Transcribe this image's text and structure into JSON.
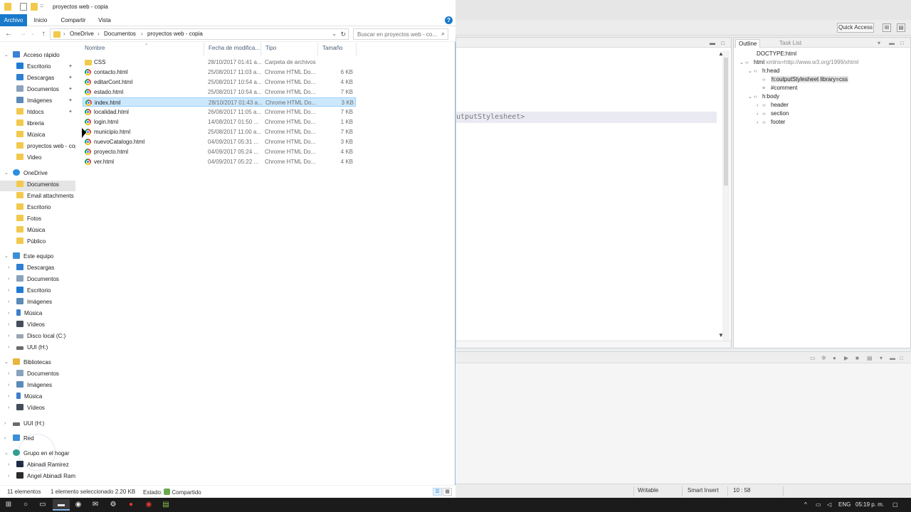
{
  "explorer": {
    "title": "proyectos web - copia",
    "ribbon_tabs": [
      "Archivo",
      "Inicio",
      "Compartir",
      "Vista"
    ],
    "help_label": "?",
    "breadcrumbs": [
      "OneDrive",
      "Documentos",
      "proyectos web - copia"
    ],
    "search_placeholder": "Buscar en proyectos web - co...",
    "columns": {
      "name": "Nombre",
      "date": "Fecha de modifica...",
      "type": "Tipo",
      "size": "Tamaño"
    },
    "files": [
      {
        "name": "CSS",
        "date": "28/10/2017 01:41 a...",
        "type": "Carpeta de archivos",
        "size": "",
        "icon": "folder-icon"
      },
      {
        "name": "contacto.html",
        "date": "25/08/2017 11:03 a...",
        "type": "Chrome HTML Do...",
        "size": "6 KB",
        "icon": "chrome-icon"
      },
      {
        "name": "editarCont.html",
        "date": "25/08/2017 10:54 a...",
        "type": "Chrome HTML Do...",
        "size": "4 KB",
        "icon": "chrome-icon"
      },
      {
        "name": "estado.html",
        "date": "25/08/2017 10:54 a...",
        "type": "Chrome HTML Do...",
        "size": "7 KB",
        "icon": "chrome-icon"
      },
      {
        "name": "index.html",
        "date": "28/10/2017 01:43 a...",
        "type": "Chrome HTML Do...",
        "size": "3 KB",
        "icon": "chrome-icon",
        "selected": true
      },
      {
        "name": "localidad.html",
        "date": "26/08/2017 11:05 a...",
        "type": "Chrome HTML Do...",
        "size": "7 KB",
        "icon": "chrome-icon"
      },
      {
        "name": "login.html",
        "date": "14/08/2017 01:50 ...",
        "type": "Chrome HTML Do...",
        "size": "1 KB",
        "icon": "chrome-icon"
      },
      {
        "name": "municipio.html",
        "date": "25/08/2017 11:00 a...",
        "type": "Chrome HTML Do...",
        "size": "7 KB",
        "icon": "chrome-icon"
      },
      {
        "name": "nuevoCatalogo.html",
        "date": "04/09/2017 05:31 ...",
        "type": "Chrome HTML Do...",
        "size": "3 KB",
        "icon": "chrome-icon"
      },
      {
        "name": "proyecto.html",
        "date": "04/09/2017 05:24 ...",
        "type": "Chrome HTML Do...",
        "size": "4 KB",
        "icon": "chrome-icon"
      },
      {
        "name": "ver.html",
        "date": "04/09/2017 05:22 ...",
        "type": "Chrome HTML Do...",
        "size": "4 KB",
        "icon": "chrome-icon"
      }
    ],
    "nav": {
      "quick_access": "Acceso rápido",
      "quick_items": [
        "Escritorio",
        "Descargas",
        "Documentos",
        "Imágenes",
        "htdocs",
        "libreria",
        "Música",
        "proyectos web - copia",
        "Video"
      ],
      "onedrive": "OneDrive",
      "onedrive_items": [
        "Documentos",
        "Email attachments",
        "Escritorio",
        "Fotos",
        "Música",
        "Público"
      ],
      "this_pc": "Este equipo",
      "pc_items": [
        "Descargas",
        "Documentos",
        "Escritorio",
        "Imágenes",
        "Música",
        "Vídeos",
        "Disco local (C:)",
        "UUI (H:)"
      ],
      "libraries": "Bibliotecas",
      "lib_items": [
        "Documentos",
        "Imágenes",
        "Música",
        "Vídeos"
      ],
      "uui": "UUI (H:)",
      "network": "Red",
      "homegroup": "Grupo en el hogar",
      "home_items": [
        "Abinadi Ramirez",
        "Angel Abinadi Ram"
      ]
    },
    "status": {
      "count": "11 elementos",
      "selection": "1 elemento seleccionado  2.20 KB",
      "state": "Estado:",
      "shared": "Compartido"
    }
  },
  "ide": {
    "quick_access": "Quick Access",
    "code_line": "utputStylesheet>",
    "outline_tab": "Outline",
    "tasklist_tab": "Task List",
    "outline": [
      {
        "text": "DOCTYPE:html",
        "attr": ""
      },
      {
        "text": "html",
        "attr": "xmlns=http://www.w3.org/1999/xhtml"
      },
      {
        "text": "h:head",
        "attr": ""
      },
      {
        "text": "h:outputStylesheet library=css",
        "attr": ""
      },
      {
        "text": "#comment",
        "attr": ""
      },
      {
        "text": "h:body",
        "attr": ""
      },
      {
        "text": "header",
        "attr": ""
      },
      {
        "text": "section",
        "attr": ""
      },
      {
        "text": "footer",
        "attr": ""
      }
    ],
    "status": {
      "writable": "Writable",
      "insert": "Smart Insert",
      "position": "10 : 58"
    }
  },
  "taskbar": {
    "lang": "ENG",
    "time": "05:19 p. m."
  },
  "colors": {
    "accent": "#1979ca",
    "selection": "#cce8ff",
    "folder": "#f2c94c"
  }
}
